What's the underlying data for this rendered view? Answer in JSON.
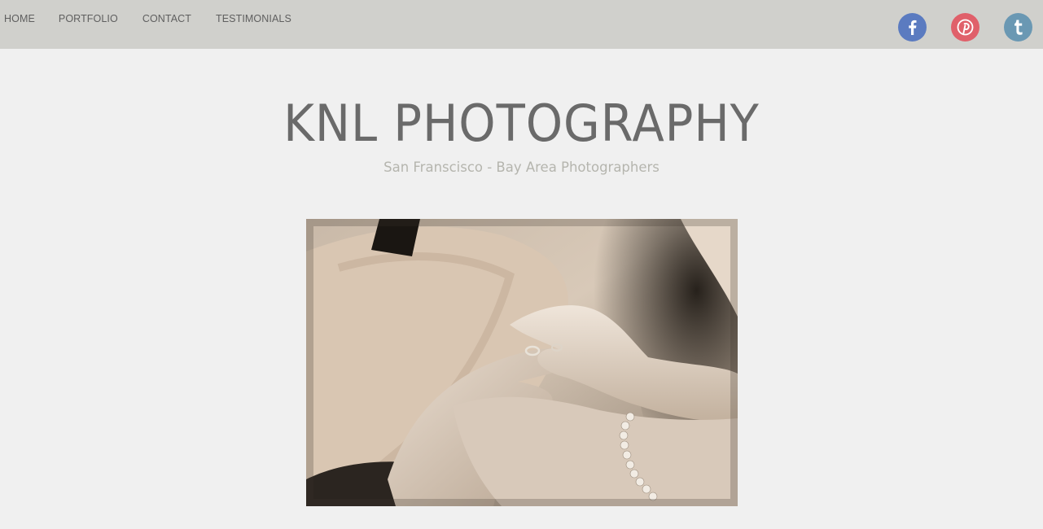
{
  "nav": {
    "items": [
      {
        "label": "HOME"
      },
      {
        "label": "PORTFOLIO"
      },
      {
        "label": "CONTACT"
      },
      {
        "label": "TESTIMONIALS"
      }
    ]
  },
  "social": [
    {
      "icon": "facebook-icon",
      "color": "#5b7bc0"
    },
    {
      "icon": "pinterest-icon",
      "color": "#e0606a"
    },
    {
      "icon": "tumblr-icon",
      "color": "#6a98b3"
    }
  ],
  "hero": {
    "title": "KNL PHOTOGRAPHY",
    "tagline": "San Franscisco - Bay Area Photographers"
  },
  "colors": {
    "topbar": "#d0d0cc",
    "page_background": "#f0f0f0",
    "title_text": "#6a6a6a",
    "tagline_text": "#b5b5ae"
  }
}
